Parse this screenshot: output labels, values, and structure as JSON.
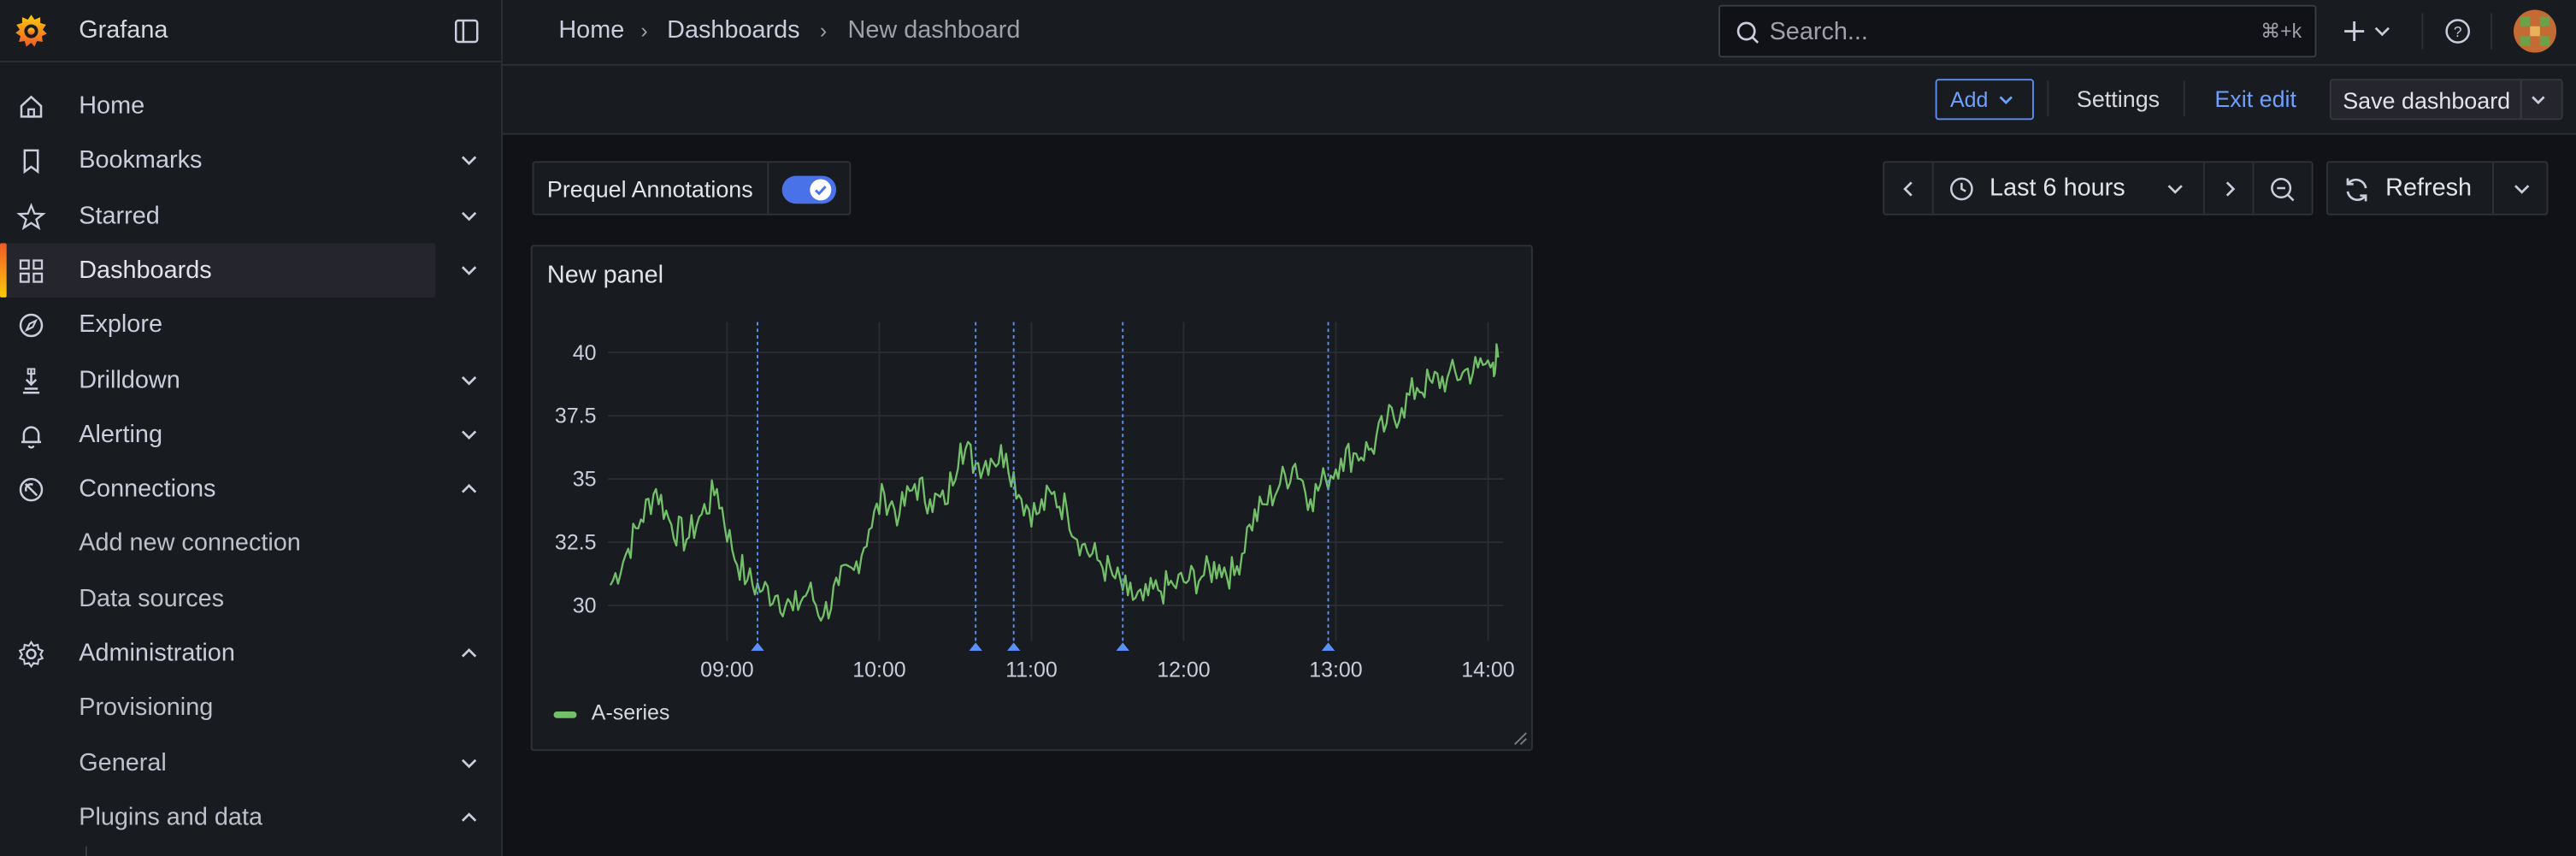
{
  "app": {
    "name": "Grafana"
  },
  "sidebar": {
    "items": [
      {
        "label": "Home",
        "icon": "home-icon",
        "chevron": "",
        "active": false
      },
      {
        "label": "Bookmarks",
        "icon": "bookmark-icon",
        "chevron": "down",
        "active": false
      },
      {
        "label": "Starred",
        "icon": "star-icon",
        "chevron": "down",
        "active": false
      },
      {
        "label": "Dashboards",
        "icon": "apps-icon",
        "chevron": "down",
        "active": true
      },
      {
        "label": "Explore",
        "icon": "compass-icon",
        "chevron": "",
        "active": false
      },
      {
        "label": "Drilldown",
        "icon": "drilldown-icon",
        "chevron": "down",
        "active": false
      },
      {
        "label": "Alerting",
        "icon": "bell-icon",
        "chevron": "down",
        "active": false
      },
      {
        "label": "Connections",
        "icon": "connections-icon",
        "chevron": "up",
        "active": false
      },
      {
        "label": "Add new connection",
        "icon": "",
        "chevron": "",
        "sub": true
      },
      {
        "label": "Data sources",
        "icon": "",
        "chevron": "",
        "sub": true
      },
      {
        "label": "Administration",
        "icon": "cog-icon",
        "chevron": "up",
        "active": false
      },
      {
        "label": "Provisioning",
        "icon": "",
        "chevron": "",
        "sub": true
      },
      {
        "label": "General",
        "icon": "",
        "chevron": "down",
        "sub": true
      },
      {
        "label": "Plugins and data",
        "icon": "",
        "chevron": "up",
        "sub": true
      }
    ]
  },
  "breadcrumb": {
    "home": "Home",
    "dashboards": "Dashboards",
    "current": "New dashboard"
  },
  "search": {
    "placeholder": "Search...",
    "shortcut": "⌘+k"
  },
  "toolbar": {
    "add_label": "Add",
    "settings_label": "Settings",
    "exit_edit_label": "Exit edit",
    "save_label": "Save dashboard"
  },
  "variables": {
    "toggle_label": "Prequel Annotations",
    "toggle_on": true
  },
  "time_picker": {
    "range_label": "Last 6 hours",
    "refresh_label": "Refresh"
  },
  "panel": {
    "title": "New panel",
    "legend_label": "A-series"
  },
  "colors": {
    "accent": "#6ea0ff",
    "series": "#73bf69",
    "annotation": "#5b8ff9",
    "active_bar": "#f05a28"
  },
  "chart_data": {
    "type": "line",
    "xlabel": "",
    "ylabel": "",
    "x_ticks": [
      "09:00",
      "10:00",
      "11:00",
      "12:00",
      "13:00",
      "14:00"
    ],
    "y_ticks": [
      "30",
      "32.5",
      "35",
      "37.5",
      "40"
    ],
    "ylim": [
      28.6,
      41.2
    ],
    "xlim": [
      "08:13",
      "14:06"
    ],
    "legend": "bottom-left",
    "grid": true,
    "annotations": [
      "09:12",
      "10:38",
      "10:53",
      "11:36",
      "12:57"
    ],
    "series": [
      {
        "name": "A-series",
        "x": [
          "08:14",
          "08:20",
          "08:26",
          "08:32",
          "08:38",
          "08:44",
          "08:50",
          "08:56",
          "09:02",
          "09:08",
          "09:14",
          "09:20",
          "09:26",
          "09:32",
          "09:38",
          "09:44",
          "09:50",
          "09:56",
          "10:02",
          "10:08",
          "10:14",
          "10:20",
          "10:26",
          "10:32",
          "10:38",
          "10:44",
          "10:50",
          "10:56",
          "11:02",
          "11:08",
          "11:14",
          "11:20",
          "11:26",
          "11:32",
          "11:38",
          "11:44",
          "11:50",
          "11:56",
          "12:02",
          "12:08",
          "12:14",
          "12:20",
          "12:26",
          "12:32",
          "12:38",
          "12:44",
          "12:50",
          "12:56",
          "13:02",
          "13:08",
          "13:14",
          "13:20",
          "13:26",
          "13:32",
          "13:38",
          "13:44",
          "13:50",
          "13:56",
          "14:02",
          "14:04"
        ],
        "y": [
          30.8,
          32.0,
          33.4,
          34.6,
          33.2,
          32.6,
          33.6,
          34.6,
          32.2,
          31.0,
          30.6,
          30.4,
          29.8,
          30.6,
          29.6,
          30.8,
          31.4,
          33.0,
          34.4,
          33.6,
          34.8,
          34.2,
          34.0,
          36.4,
          35.6,
          35.8,
          36.0,
          34.2,
          33.6,
          34.4,
          33.8,
          32.4,
          31.8,
          31.2,
          30.4,
          30.2,
          30.6,
          30.8,
          31.0,
          31.2,
          31.6,
          31.2,
          33.2,
          34.0,
          34.8,
          35.6,
          34.2,
          35.0,
          35.8,
          36.0,
          36.2,
          37.2,
          37.8,
          38.6,
          38.8,
          39.0,
          39.2,
          39.4,
          39.6,
          39.8
        ]
      }
    ]
  }
}
